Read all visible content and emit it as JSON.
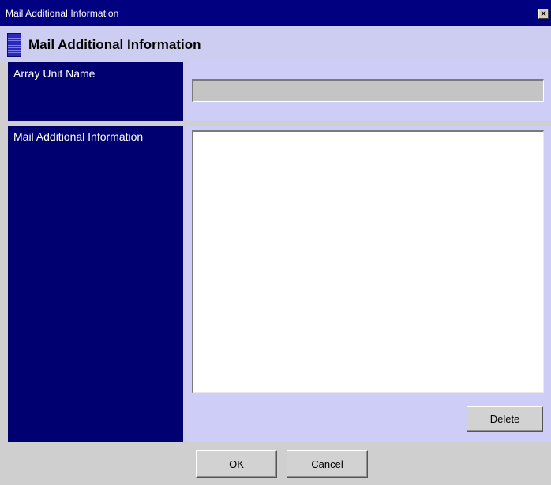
{
  "window": {
    "title": "Mail Additional Information",
    "close_glyph": "×"
  },
  "header": {
    "title": "Mail Additional Information",
    "icon": "panel-icon"
  },
  "array_unit": {
    "label": "Array Unit Name",
    "value": ""
  },
  "mail_info": {
    "label": "Mail Additional Information",
    "value": ""
  },
  "buttons": {
    "delete": "Delete",
    "ok": "OK",
    "cancel": "Cancel"
  },
  "colors": {
    "titlebar": "#000080",
    "label_panel": "#000070",
    "field_panel": "#cdcdf8",
    "header_bg": "#cdcdf1"
  }
}
